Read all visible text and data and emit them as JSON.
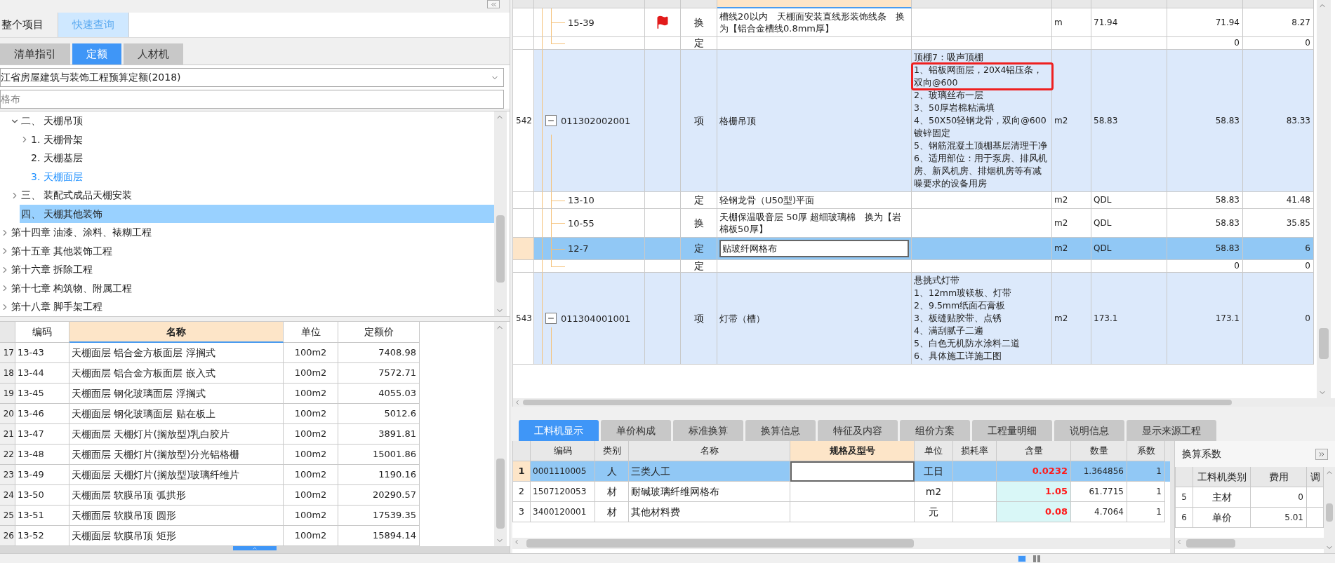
{
  "left_panel": {
    "scope_tabs": [
      {
        "label": "整个项目",
        "selected": false
      },
      {
        "label": "快速查询",
        "selected": true
      }
    ],
    "library_tabs": [
      {
        "label": "清单指引",
        "selected": false
      },
      {
        "label": "定额",
        "selected": true
      },
      {
        "label": "人材机",
        "selected": false
      }
    ],
    "library_select": {
      "value": "江省房屋建筑与装饰工程预算定额(2018)"
    },
    "search": {
      "value": "格布"
    },
    "tree": {
      "section_nodes": [
        {
          "label": "二、 天棚吊顶",
          "kind": "branch",
          "expanded": true,
          "selected": false,
          "active": false,
          "children": [
            {
              "label": "1. 天棚骨架",
              "kind": "branch",
              "expanded": false,
              "selected": false,
              "active": false
            },
            {
              "label": "2. 天棚基层",
              "kind": "leaf",
              "selected": false,
              "active": false
            },
            {
              "label": "3. 天棚面层",
              "kind": "leaf",
              "selected": false,
              "active": true
            }
          ]
        },
        {
          "label": "三、 装配式成品天棚安装",
          "kind": "branch",
          "expanded": false,
          "selected": false,
          "active": false
        },
        {
          "label": "四、 天棚其他装饰",
          "kind": "leaf",
          "selected": true,
          "active": false
        }
      ],
      "chapters": [
        {
          "label": "第十四章 油漆、涂料、裱糊工程",
          "kind": "branch",
          "expanded": false,
          "selected": false,
          "active": false
        },
        {
          "label": "第十五章 其他装饰工程",
          "kind": "branch",
          "expanded": false,
          "selected": false,
          "active": false
        },
        {
          "label": "第十六章 拆除工程",
          "kind": "branch",
          "expanded": false,
          "selected": false,
          "active": false
        },
        {
          "label": "第十七章 构筑物、附属工程",
          "kind": "branch",
          "expanded": false,
          "selected": false,
          "active": false
        },
        {
          "label": "第十八章 脚手架工程",
          "kind": "branch",
          "expanded": false,
          "selected": false,
          "active": false
        }
      ]
    },
    "quota_table": {
      "columns": [
        {
          "label": "编码",
          "selected": false
        },
        {
          "label": "名称",
          "selected": true
        },
        {
          "label": "单位",
          "selected": false
        },
        {
          "label": "定额价",
          "selected": false
        }
      ],
      "rows": [
        {
          "index": "17",
          "code": "13-43",
          "name": "天棚面层 铝合金方板面层 浮搁式",
          "unit": "100m2",
          "price": "7408.98"
        },
        {
          "index": "18",
          "code": "13-44",
          "name": "天棚面层 铝合金方板面层 嵌入式",
          "unit": "100m2",
          "price": "7572.71"
        },
        {
          "index": "19",
          "code": "13-45",
          "name": "天棚面层 钢化玻璃面层 浮搁式",
          "unit": "100m2",
          "price": "4055.03"
        },
        {
          "index": "20",
          "code": "13-46",
          "name": "天棚面层 钢化玻璃面层 贴在板上",
          "unit": "100m2",
          "price": "5012.6"
        },
        {
          "index": "21",
          "code": "13-47",
          "name": "天棚面层 天棚灯片(搁放型)乳白胶片",
          "unit": "100m2",
          "price": "3891.81"
        },
        {
          "index": "22",
          "code": "13-48",
          "name": "天棚面层 天棚灯片(搁放型)分光铝格栅",
          "unit": "100m2",
          "price": "15001.86"
        },
        {
          "index": "23",
          "code": "13-49",
          "name": "天棚面层 天棚灯片(搁放型)玻璃纤维片",
          "unit": "100m2",
          "price": "1190.16"
        },
        {
          "index": "24",
          "code": "13-50",
          "name": "天棚面层 软膜吊顶 弧拱形",
          "unit": "100m2",
          "price": "20290.57"
        },
        {
          "index": "25",
          "code": "13-51",
          "name": "天棚面层 软膜吊顶 圆形",
          "unit": "100m2",
          "price": "17539.35"
        },
        {
          "index": "26",
          "code": "13-52",
          "name": "天棚面层 软膜吊顶 矩形",
          "unit": "100m2",
          "price": "15894.14"
        }
      ]
    }
  },
  "bill_table": {
    "rows": [
      {
        "kind": "quota",
        "selected": false,
        "flagged": true,
        "code": "15-39",
        "type": "换",
        "name": "槽线20以内　天棚面安装直线形装饰线条　换为【铝合金槽线0.8mm厚】",
        "unit": "m",
        "expr": "71.94",
        "qty": "71.94",
        "price": "8.27"
      },
      {
        "kind": "quota",
        "selected": false,
        "flagged": false,
        "type": "定",
        "qty": "0",
        "price": "0"
      },
      {
        "kind": "bill",
        "selected": false,
        "flagged": false,
        "expanded": true,
        "index": "542",
        "code": "011302002001",
        "type": "项",
        "name": "格栅吊顶",
        "features": [
          {
            "text": "顶棚7：吸声顶棚",
            "highlighted": false
          },
          {
            "text": "1、铝板网面层，20X4铝压条，双向@600",
            "highlighted": true
          },
          {
            "text": "2、玻璃丝布一层",
            "highlighted": false
          },
          {
            "text": "3、50厚岩棉粘满填",
            "highlighted": false
          },
          {
            "text": "4、50X50轻钢龙骨，双向@600镀锌固定",
            "highlighted": false
          },
          {
            "text": "5、钢筋混凝土顶棚基层清理干净",
            "highlighted": false
          },
          {
            "text": "6、适用部位：用于泵房、排风机房、新风机房、排烟机房等有减噪要求的设备用房",
            "highlighted": false
          }
        ],
        "unit": "m2",
        "expr": "58.83",
        "qty": "58.83",
        "price": "83.33"
      },
      {
        "kind": "quota",
        "selected": false,
        "flagged": false,
        "code": "13-10",
        "type": "定",
        "name": "轻钢龙骨（U50型)平面",
        "unit": "m2",
        "expr": "QDL",
        "qty": "58.83",
        "price": "41.48"
      },
      {
        "kind": "quota",
        "selected": false,
        "flagged": false,
        "code": "10-55",
        "type": "换",
        "name": "天棚保温吸音层 50厚 超细玻璃棉　换为【岩棉板50厚】",
        "unit": "m2",
        "expr": "QDL",
        "qty": "58.83",
        "price": "35.85"
      },
      {
        "kind": "quota",
        "selected": true,
        "flagged": false,
        "code": "12-7",
        "type": "定",
        "name": "贴玻纤网格布",
        "unit": "m2",
        "expr": "QDL",
        "qty": "58.83",
        "price": "6"
      },
      {
        "kind": "quota",
        "selected": false,
        "flagged": false,
        "type": "定",
        "qty": "0",
        "price": "0"
      },
      {
        "kind": "bill",
        "selected": false,
        "flagged": false,
        "expanded": true,
        "index": "543",
        "code": "011304001001",
        "type": "项",
        "name": "灯带（槽）",
        "features": [
          {
            "text": "悬挑式灯带",
            "highlighted": false
          },
          {
            "text": "1、12mm玻镁板、灯带",
            "highlighted": false
          },
          {
            "text": "2、9.5mm纸面石膏板",
            "highlighted": false
          },
          {
            "text": "3、板缝贴胶带、点锈",
            "highlighted": false
          },
          {
            "text": "4、满刮腻子二遍",
            "highlighted": false
          },
          {
            "text": "5、白色无机防水涂料二道",
            "highlighted": false
          },
          {
            "text": "6、具体施工详施工图",
            "highlighted": false
          }
        ],
        "unit": "m2",
        "expr": "173.1",
        "qty": "173.1",
        "price": "0"
      }
    ]
  },
  "detail_tabs": [
    {
      "label": "工料机显示",
      "selected": true
    },
    {
      "label": "单价构成",
      "selected": false
    },
    {
      "label": "标准换算",
      "selected": false
    },
    {
      "label": "换算信息",
      "selected": false
    },
    {
      "label": "特征及内容",
      "selected": false
    },
    {
      "label": "组价方案",
      "selected": false
    },
    {
      "label": "工程量明细",
      "selected": false
    },
    {
      "label": "说明信息",
      "selected": false
    },
    {
      "label": "显示来源工程",
      "selected": false
    }
  ],
  "resource_table": {
    "columns": [
      {
        "label": "编码",
        "selected": false
      },
      {
        "label": "类别",
        "selected": false
      },
      {
        "label": "名称",
        "selected": false
      },
      {
        "label": "规格及型号",
        "selected": true
      },
      {
        "label": "单位",
        "selected": false
      },
      {
        "label": "损耗率",
        "selected": false
      },
      {
        "label": "含量",
        "selected": false
      },
      {
        "label": "数量",
        "selected": false
      },
      {
        "label": "系数",
        "selected": false
      }
    ],
    "rows": [
      {
        "index": "1",
        "selected": true,
        "code": "0001110005",
        "category": "人",
        "name": "三类人工",
        "unit": "工日",
        "content": "0.0232",
        "quantity": "1.364856",
        "factor": "1"
      },
      {
        "index": "2",
        "selected": false,
        "code": "1507120053",
        "category": "材",
        "name": "耐碱玻璃纤维网格布",
        "unit": "m2",
        "content": "1.05",
        "quantity": "61.7715",
        "factor": "1"
      },
      {
        "index": "3",
        "selected": false,
        "code": "3400120001",
        "category": "材",
        "name": "其他材料费",
        "unit": "元",
        "content": "0.08",
        "quantity": "4.7064",
        "factor": "1"
      }
    ]
  },
  "factor_panel": {
    "title": "换算系数",
    "columns": [
      "工料机类别",
      "费用",
      "调"
    ],
    "rows": [
      {
        "index": "5",
        "category": "主材",
        "cost": "0"
      },
      {
        "index": "6",
        "category": "单价",
        "cost": "5.01"
      }
    ]
  }
}
